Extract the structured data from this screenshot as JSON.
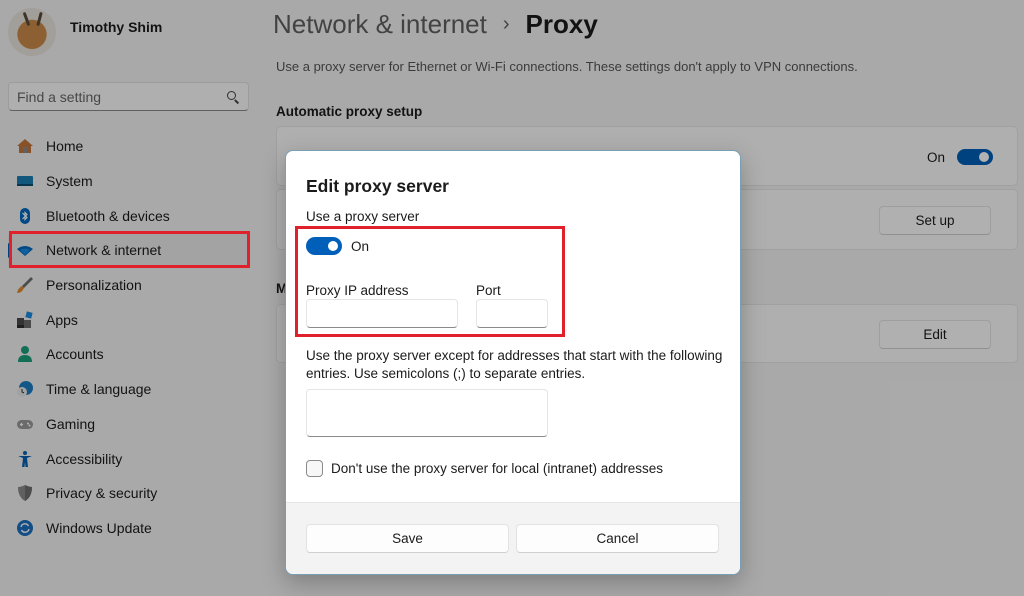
{
  "sidebar": {
    "profile_name": "Timothy Shim",
    "search_placeholder": "Find a setting",
    "items": [
      {
        "label": "Home",
        "icon": "home-icon"
      },
      {
        "label": "System",
        "icon": "system-icon"
      },
      {
        "label": "Bluetooth & devices",
        "icon": "bluetooth-icon"
      },
      {
        "label": "Network & internet",
        "icon": "wifi-icon",
        "active": true
      },
      {
        "label": "Personalization",
        "icon": "brush-icon"
      },
      {
        "label": "Apps",
        "icon": "apps-icon"
      },
      {
        "label": "Accounts",
        "icon": "account-icon"
      },
      {
        "label": "Time & language",
        "icon": "globe-clock-icon"
      },
      {
        "label": "Gaming",
        "icon": "gamepad-icon"
      },
      {
        "label": "Accessibility",
        "icon": "accessibility-icon"
      },
      {
        "label": "Privacy & security",
        "icon": "shield-icon"
      },
      {
        "label": "Windows Update",
        "icon": "update-icon"
      }
    ]
  },
  "main": {
    "breadcrumb_parent": "Network & internet",
    "breadcrumb_separator": "›",
    "breadcrumb_current": "Proxy",
    "description": "Use a proxy server for Ethernet or Wi-Fi connections. These settings don't apply to VPN connections.",
    "auto_section_title": "Automatic proxy setup",
    "manual_section_title_partial": "M",
    "auto_detect_toggle_label": "On",
    "setup_button": "Set up",
    "edit_button": "Edit"
  },
  "dialog": {
    "title": "Edit proxy server",
    "use_proxy_label": "Use a proxy server",
    "toggle_state_label": "On",
    "proxy_ip_label": "Proxy IP address",
    "proxy_ip_value": "",
    "port_label": "Port",
    "port_value": "",
    "exceptions_text": "Use the proxy server except for addresses that start with the following entries. Use semicolons (;) to separate entries.",
    "exceptions_value": "",
    "local_checkbox_label": "Don't use the proxy server for local (intranet) addresses",
    "local_checkbox_checked": false,
    "save_button": "Save",
    "cancel_button": "Cancel"
  },
  "colors": {
    "accent": "#005fb8",
    "highlight": "#e0202a"
  }
}
